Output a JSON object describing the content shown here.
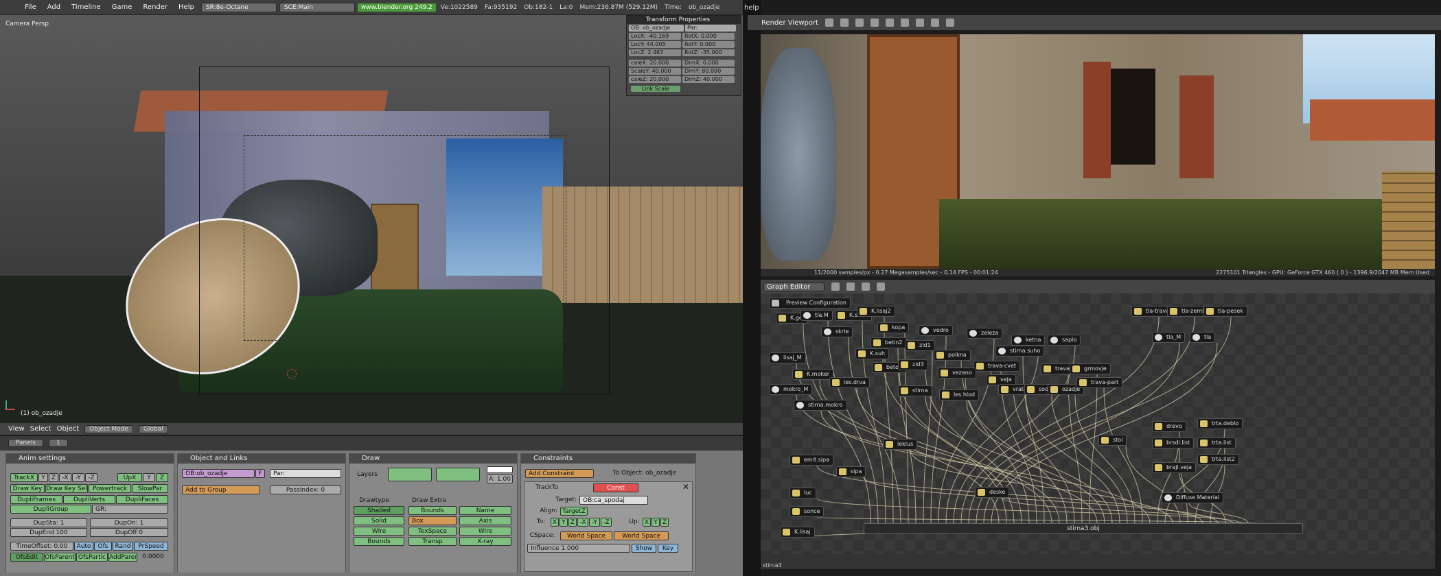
{
  "topbar": {
    "menus": [
      "File",
      "Add",
      "Timeline",
      "Game",
      "Render",
      "Help"
    ],
    "screen": "SR:8e-Octane",
    "scene": "SCE:Main",
    "url": "www.blender.org 249.2",
    "stats": [
      "Ve:1022589",
      "Fa:935192",
      "Ob:182-1",
      "La:0",
      "Mem:236.87M (529.12M)",
      "Time:",
      "ob_ozadje"
    ]
  },
  "viewport3d": {
    "view_label": "Camera Persp",
    "object_label": "(1) ob_ozadje"
  },
  "transform_properties": {
    "title": "Transform Properties",
    "ob": "OB: ob_ozadje",
    "par": "Par:",
    "loc": [
      "LocX: -40.169",
      "LocY: 44.005",
      "LocZ: 2.467"
    ],
    "rot": [
      "RotX: 0.000",
      "RotY: 0.000",
      "RotZ: -35.000"
    ],
    "scale": [
      "caleX: 20.000",
      "ScaleY: 40.000",
      "caleZ: 20.000"
    ],
    "dim": [
      "DimX: 0.000",
      "DimY: 80.000",
      "DimZ: 40.000"
    ],
    "link_scale": "Link Scale"
  },
  "viewport_header": {
    "menus": [
      "View",
      "Select",
      "Object"
    ],
    "mode": "Object Mode",
    "orientation": "Global"
  },
  "buttons_header": {
    "panels": "Panels",
    "frame": "1"
  },
  "anim_settings": {
    "title": "Anim settings",
    "track": [
      "TrackX",
      "Y",
      "Z",
      "-X",
      "-Y",
      "-Z"
    ],
    "up": [
      "UpX",
      "Y",
      "Z"
    ],
    "row2": [
      "Draw Key",
      "Draw Key Sel",
      "Powertrack",
      "SlowPar"
    ],
    "row3": [
      "DupliFrames",
      "DupliVerts",
      "DupliFaces"
    ],
    "dupligroup": "DupliGroup",
    "gr": "GR:",
    "dupsta": "DupSta: 1",
    "dupon": "DupOn: 1",
    "dupend": "DupEnd 100",
    "dupoff": "DupOff 0",
    "time_row": [
      "TimeOffset: 0.00",
      "Auto",
      "Ofs",
      "Rand",
      "PrSpeed"
    ],
    "ofs_row": [
      "OfsEdit",
      "OfsParent",
      "OfsPartic",
      "AddParent"
    ],
    "value": "0.0000"
  },
  "object_links": {
    "title": "Object and Links",
    "ob": "OB:ob_ozadje",
    "f": "F",
    "par": "Par:",
    "add_group": "Add to Group",
    "passindex": "PassIndex: 0"
  },
  "draw": {
    "title": "Draw",
    "layers": "Layers",
    "alpha": "A: 1.00",
    "drawtype_label": "Drawtype",
    "drawtype": [
      "Shaded",
      "Solid",
      "Wire",
      "Bounds"
    ],
    "drawextra_label": "Draw Extra",
    "bounds": "Bounds",
    "box": "Box",
    "name": "Name",
    "axis": "Axis",
    "texspace": "TexSpace",
    "wire": "Wire",
    "transp": "Transp",
    "xray": "X-ray"
  },
  "constraints": {
    "title": "Constraints",
    "add": "Add Constraint",
    "to_object": "To Object: ob_ozadje",
    "trackto": "TrackTo",
    "const": "Const",
    "target_label": "Target:",
    "target": "OB:ca_spodaj",
    "align_label": "Align:",
    "align": "TargetZ",
    "to_label": "To:",
    "to": [
      "X",
      "Y",
      "Z",
      "-X",
      "-Y",
      "-Z"
    ],
    "up_label": "Up:",
    "up": [
      "X",
      "Y",
      "Z"
    ],
    "cspace_label": "CSpace:",
    "cspace": [
      "World Space",
      "World Space"
    ],
    "influence": "Influence 1.000",
    "show": "Show",
    "key": "Key"
  },
  "divider_text": "help",
  "render_viewport": {
    "title": "Render Viewport",
    "status_left": "11/2000 samples/px - 0.27 Megasamples/sec - 0.14 FPS - 00:01:24",
    "status_right": "2275101 Triangles - GPU: GeForce GTX 460 ( 0 ) - 1396.9/2047 MB Mem Used"
  },
  "graph_editor": {
    "title": "Graph Editor",
    "preview": "Preview Configuration",
    "nodes": [
      "K.gol",
      "tla.M",
      "K.skrla",
      "K.lisaj2",
      "skrle",
      "kopa",
      "betin2",
      "zid1",
      "vedro",
      "zeleza",
      "ketna",
      "saplo",
      "tla-trava",
      "tla-zemlja",
      "tla-pesek",
      "tla_M",
      "tla",
      "lisaj_M",
      "K.suh",
      "beton",
      "zid3",
      "polkna",
      "trava-cvet",
      "stirna.suho",
      "K.moker",
      "les.drva",
      "vezano",
      "veja",
      "trava-bilke",
      "grmovje",
      "mokro_M",
      "stirna",
      "les.hlod",
      "vrata",
      "soda",
      "ozadje",
      "trava-part",
      "stirna.mokro",
      "drevo",
      "trta.deblo",
      "leklus",
      "stol",
      "brsdi.list",
      "trta.list",
      "emit.sipa",
      "trta.list2",
      "sipa",
      "brajl.veja",
      "deske",
      "luc",
      "Diffuse Material",
      "sonce",
      "K.lisaj"
    ],
    "big_node": "stirna3.obj",
    "tab": "stirna3"
  }
}
